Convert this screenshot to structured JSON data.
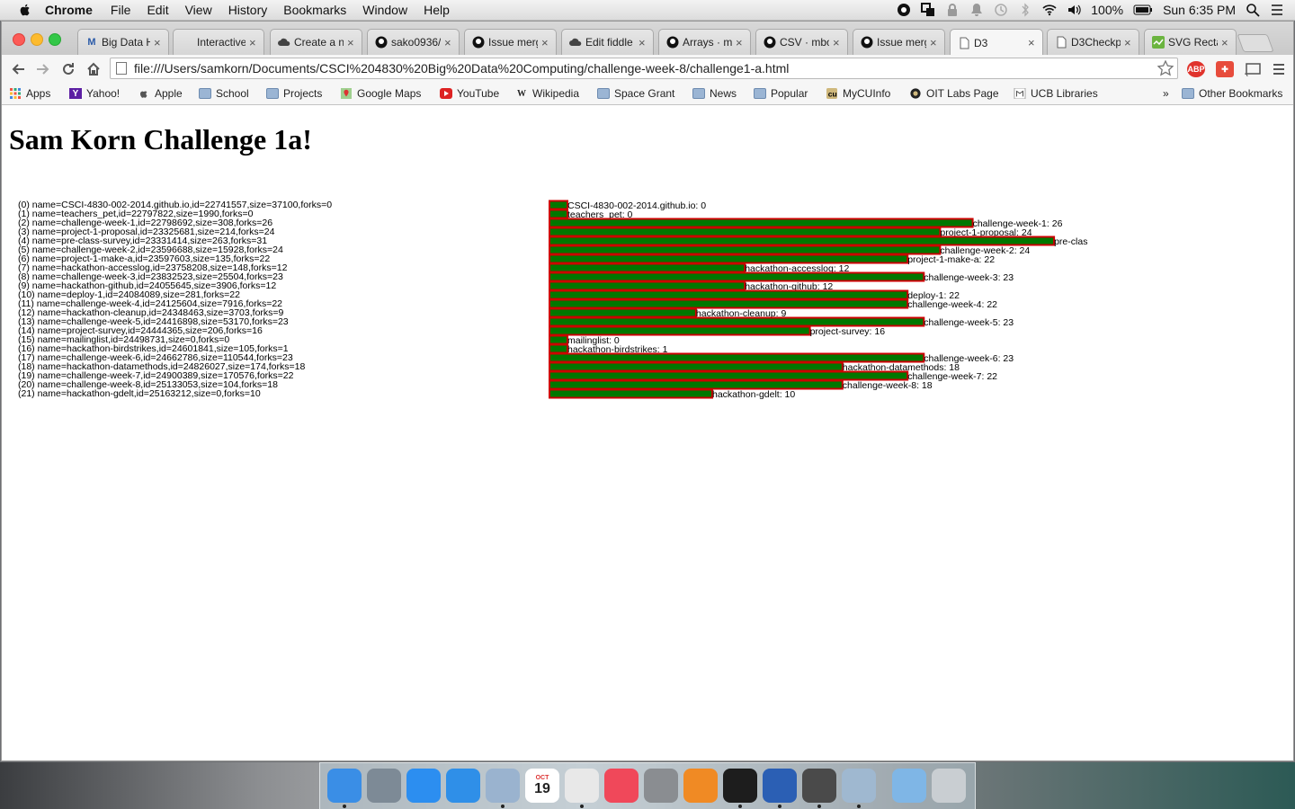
{
  "menubar": {
    "app_name": "Chrome",
    "items": [
      "File",
      "Edit",
      "View",
      "History",
      "Bookmarks",
      "Window",
      "Help"
    ],
    "battery": "100%",
    "clock": "Sun 6:35 PM"
  },
  "tabs": [
    {
      "label": "Big Data H",
      "icon": "M"
    },
    {
      "label": "Interactive",
      "icon": ""
    },
    {
      "label": "Create a n",
      "icon": "cloud"
    },
    {
      "label": "sako0936/",
      "icon": "github"
    },
    {
      "label": "Issue merg",
      "icon": "github"
    },
    {
      "label": "Edit fiddle",
      "icon": "cloud"
    },
    {
      "label": "Arrays · ml",
      "icon": "github"
    },
    {
      "label": "CSV · mbo",
      "icon": "github"
    },
    {
      "label": "Issue merg",
      "icon": "github"
    },
    {
      "label": "D3",
      "icon": "page"
    },
    {
      "label": "D3Checkp",
      "icon": "page"
    },
    {
      "label": "SVG Recta",
      "icon": "svg"
    }
  ],
  "address_bar": {
    "url": "file:///Users/samkorn/Documents/CSCI%204830%20Big%20Data%20Computing/challenge-week-8/challenge1-a.html"
  },
  "extensions": {
    "abp": "ABP"
  },
  "bookmarks": [
    {
      "label": "Apps",
      "icon": "apps-grid"
    },
    {
      "label": "Yahoo!",
      "icon": "Y"
    },
    {
      "label": "Apple",
      "icon": "apple"
    },
    {
      "label": "School",
      "icon": "folder"
    },
    {
      "label": "Projects",
      "icon": "folder"
    },
    {
      "label": "Google Maps",
      "icon": "maps"
    },
    {
      "label": "YouTube",
      "icon": "youtube"
    },
    {
      "label": "Wikipedia",
      "icon": "W"
    },
    {
      "label": "Space Grant",
      "icon": "folder"
    },
    {
      "label": "News",
      "icon": "folder"
    },
    {
      "label": "Popular",
      "icon": "folder"
    },
    {
      "label": "MyCUInfo",
      "icon": "cu"
    },
    {
      "label": "OIT Labs Page",
      "icon": "oit"
    },
    {
      "label": "UCB Libraries",
      "icon": "ucb"
    }
  ],
  "bookmarks_more": "»",
  "other_bookmarks": "Other Bookmarks",
  "page": {
    "title": "Sam Korn Challenge 1a!",
    "repo_lines": [
      "(0) name=CSCI-4830-002-2014.github.io,id=22741557,size=37100,forks=0",
      "(1) name=teachers_pet,id=22797822,size=1990,forks=0",
      "(2) name=challenge-week-1,id=22798692,size=308,forks=26",
      "(3) name=project-1-proposal,id=23325681,size=214,forks=24",
      "(4) name=pre-class-survey,id=23331414,size=263,forks=31",
      "(5) name=challenge-week-2,id=23596688,size=15928,forks=24",
      "(6) name=project-1-make-a,id=23597603,size=135,forks=22",
      "(7) name=hackathon-accesslog,id=23758208,size=148,forks=12",
      "(8) name=challenge-week-3,id=23832523,size=25504,forks=23",
      "(9) name=hackathon-github,id=24055645,size=3906,forks=12",
      "(10) name=deploy-1,id=24084089,size=281,forks=22",
      "(11) name=challenge-week-4,id=24125604,size=7916,forks=22",
      "(12) name=hackathon-cleanup,id=24348463,size=3703,forks=9",
      "(13) name=challenge-week-5,id=24416898,size=53170,forks=23",
      "(14) name=project-survey,id=24444365,size=206,forks=16",
      "(15) name=mailinglist,id=24498731,size=0,forks=0",
      "(16) name=hackathon-birdstrikes,id=24601841,size=105,forks=1",
      "(17) name=challenge-week-6,id=24662786,size=110544,forks=23",
      "(18) name=hackathon-datamethods,id=24826027,size=174,forks=18",
      "(19) name=challenge-week-7,id=24900389,size=170576,forks=22",
      "(20) name=challenge-week-8,id=25133053,size=104,forks=18",
      "(21) name=hackathon-gdelt,id=25163212,size=0,forks=10"
    ]
  },
  "chart_data": {
    "type": "bar",
    "orientation": "horizontal",
    "categories": [
      "CSCI-4830-002-2014.github.io",
      "teachers_pet",
      "challenge-week-1",
      "project-1-proposal",
      "pre-class-survey",
      "challenge-week-2",
      "project-1-make-a",
      "hackathon-accesslog",
      "challenge-week-3",
      "hackathon-github",
      "deploy-1",
      "challenge-week-4",
      "hackathon-cleanup",
      "challenge-week-5",
      "project-survey",
      "mailinglist",
      "hackathon-birdstrikes",
      "challenge-week-6",
      "hackathon-datamethods",
      "challenge-week-7",
      "challenge-week-8",
      "hackathon-gdelt"
    ],
    "values": [
      0,
      0,
      26,
      24,
      31,
      24,
      22,
      12,
      23,
      12,
      22,
      22,
      9,
      23,
      16,
      0,
      1,
      23,
      18,
      22,
      18,
      10
    ],
    "data_labels": [
      "CSCI-4830-002-2014.github.io: 0",
      "teachers_pet: 0",
      "challenge-week-1: 26",
      "project-1-proposal: 24",
      "pre-clas",
      "challenge-week-2: 24",
      "project-1-make-a: 22",
      "hackathon-accesslog: 12",
      "challenge-week-3: 23",
      "hackathon-github: 12",
      "deploy-1: 22",
      "challenge-week-4: 22",
      "hackathon-cleanup: 9",
      "challenge-week-5: 23",
      "project-survey: 16",
      "mailinglist: 0",
      "hackathon-birdstrikes: 1",
      "challenge-week-6: 23",
      "hackathon-datamethods: 18",
      "challenge-week-7: 22",
      "challenge-week-8: 18",
      "hackathon-gdelt: 10"
    ],
    "bar_fill": "#007700",
    "bar_stroke": "#cc0000",
    "title": "",
    "xlabel": "",
    "ylabel": ""
  },
  "dock": [
    {
      "name": "finder",
      "color": "#3a8ee6"
    },
    {
      "name": "launchpad",
      "color": "#7d8a96"
    },
    {
      "name": "app-store",
      "color": "#2c8ef0"
    },
    {
      "name": "safari",
      "color": "#2f8fe8"
    },
    {
      "name": "mail",
      "color": "#9ab3cf"
    },
    {
      "name": "calendar",
      "color": "#ffffff"
    },
    {
      "name": "chrome",
      "color": "#e8e8e8"
    },
    {
      "name": "itunes",
      "color": "#f0485a"
    },
    {
      "name": "system-preferences",
      "color": "#8a8d91"
    },
    {
      "name": "ibooks",
      "color": "#f08a24"
    },
    {
      "name": "terminal",
      "color": "#1d1d1d"
    },
    {
      "name": "word",
      "color": "#2b5fb4"
    },
    {
      "name": "sublime-text",
      "color": "#4a4a4a"
    },
    {
      "name": "preview",
      "color": "#9fb8d0"
    },
    {
      "name": "downloads-folder",
      "color": "#7fb6e6"
    },
    {
      "name": "trash",
      "color": "#c9ced2"
    }
  ],
  "calendar_day": "19",
  "calendar_month": "OCT"
}
